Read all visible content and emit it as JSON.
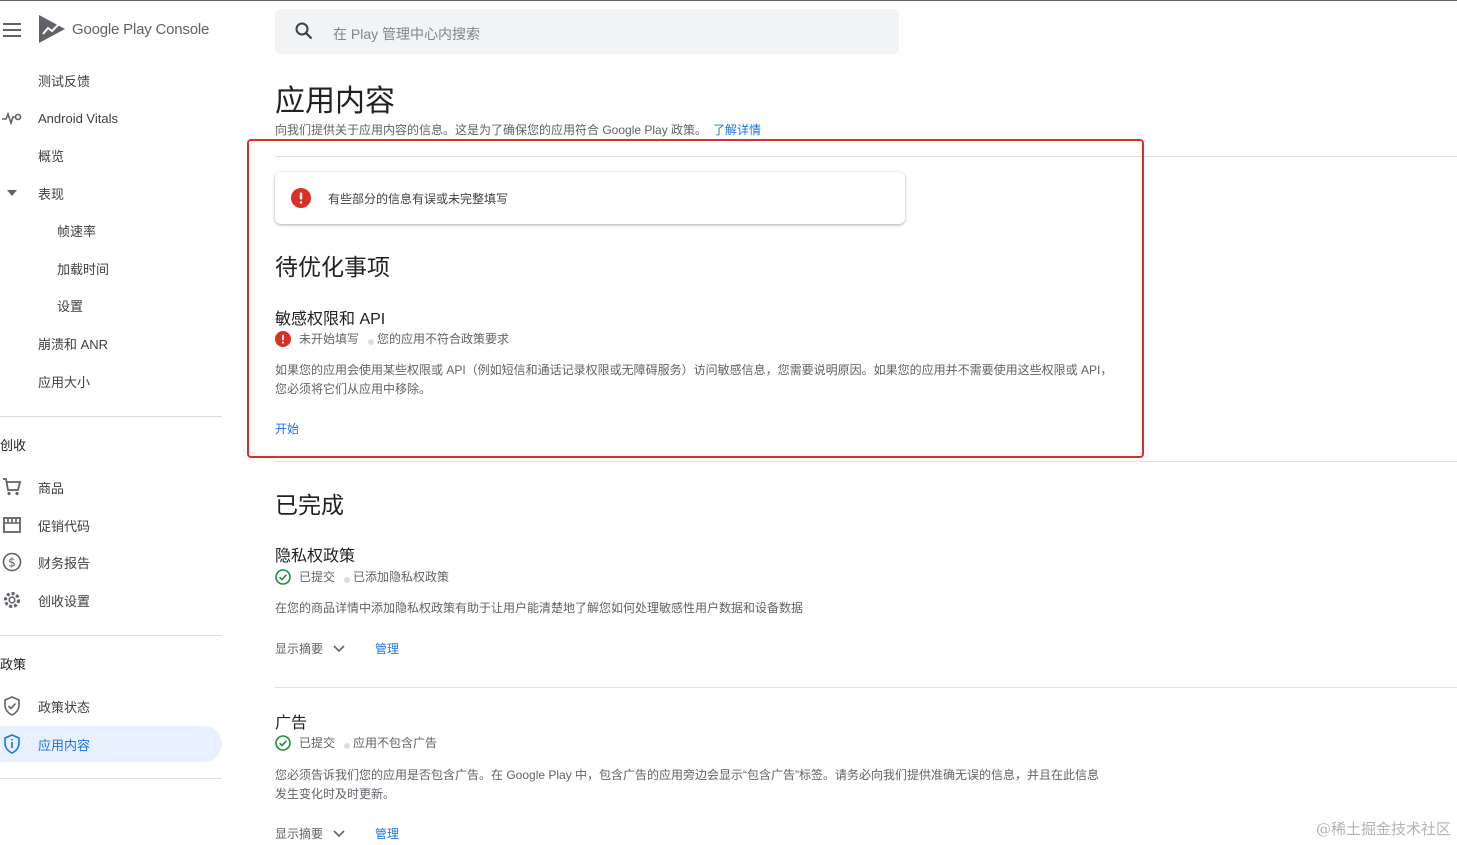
{
  "app": {
    "logo_text": "Google Play Console"
  },
  "search": {
    "placeholder": "在 Play 管理中心内搜索"
  },
  "sidebar": {
    "items": [
      {
        "label": "测试反馈"
      },
      {
        "label": "Android Vitals"
      },
      {
        "label": "概览"
      },
      {
        "label": "表现"
      },
      {
        "label": "帧速率"
      },
      {
        "label": "加载时间"
      },
      {
        "label": "设置"
      },
      {
        "label": "崩溃和 ANR"
      },
      {
        "label": "应用大小"
      }
    ],
    "monetize": {
      "heading": "创收",
      "items": [
        {
          "label": "商品"
        },
        {
          "label": "促销代码"
        },
        {
          "label": "财务报告"
        },
        {
          "label": "创收设置"
        }
      ]
    },
    "policy": {
      "heading": "政策",
      "items": [
        {
          "label": "政策状态"
        },
        {
          "label": "应用内容"
        }
      ]
    }
  },
  "main": {
    "title": "应用内容",
    "description": "向我们提供关于应用内容的信息。这是为了确保您的应用符合 Google Play 政策。",
    "learn_more": "了解详情",
    "alert": "有些部分的信息有误或未完整填写",
    "pending": {
      "heading": "待优化事项",
      "items": [
        {
          "title": "敏感权限和 API",
          "status": "未开始填写",
          "status_detail": "您的应用不符合政策要求",
          "body": "如果您的应用会使用某些权限或 API（例如短信和通话记录权限或无障碍服务）访问敏感信息，您需要说明原因。如果您的应用并不需要使用这些权限或 API，您必须将它们从应用中移除。",
          "action": "开始"
        }
      ]
    },
    "completed": {
      "heading": "已完成",
      "items": [
        {
          "title": "隐私权政策",
          "status": "已提交",
          "status_detail": "已添加隐私权政策",
          "body": "在您的商品详情中添加隐私权政策有助于让用户能清楚地了解您如何处理敏感性用户数据和设备数据",
          "summary": "显示摘要",
          "action": "管理"
        },
        {
          "title": "广告",
          "status": "已提交",
          "status_detail": "应用不包含广告",
          "body": "您必须告诉我们您的应用是否包含广告。在 Google Play 中，包含广告的应用旁边会显示“包含广告”标签。请务必向我们提供准确无误的信息，并且在此信息发生变化时及时更新。",
          "summary": "显示摘要",
          "action": "管理"
        }
      ]
    }
  },
  "watermark": "@稀土掘金技术社区",
  "colors": {
    "accent": "#1a73e8",
    "error": "#d93025",
    "success": "#1e8e3e",
    "highlight_border": "#d93025"
  }
}
